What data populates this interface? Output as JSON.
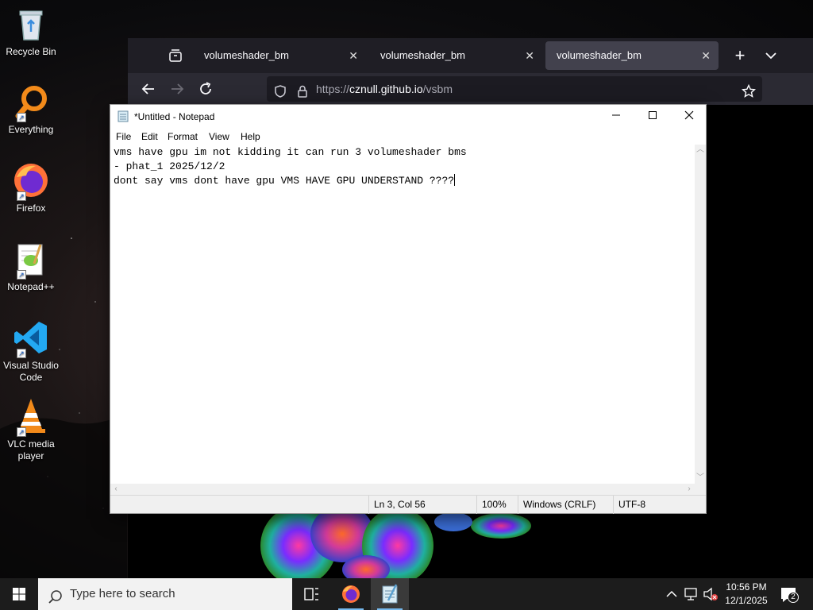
{
  "desktop": {
    "icons": [
      {
        "label": "Recycle Bin",
        "icon": "recycle-bin-icon"
      },
      {
        "label": "Everything",
        "icon": "everything-search-icon"
      },
      {
        "label": "Firefox",
        "icon": "firefox-icon"
      },
      {
        "label": "Notepad++",
        "icon": "notepadpp-icon"
      },
      {
        "label": "Visual Studio Code",
        "icon": "vscode-icon"
      },
      {
        "label": "VLC media player",
        "icon": "vlc-icon"
      }
    ]
  },
  "firefox": {
    "tabs": [
      {
        "title": "volumeshader_bm",
        "active": false
      },
      {
        "title": "volumeshader_bm",
        "active": false
      },
      {
        "title": "volumeshader_bm",
        "active": true
      }
    ],
    "url": {
      "prefix": "https://",
      "domain": "cznull.github.io",
      "path": "/vsbm"
    }
  },
  "notepad": {
    "title": "*Untitled - Notepad",
    "menu": [
      "File",
      "Edit",
      "Format",
      "View",
      "Help"
    ],
    "lines": [
      "vms have gpu im not kidding it can run 3 volumeshader bms",
      "- phat_1 2025/12/2",
      "dont say vms dont have gpu VMS HAVE GPU UNDERSTAND ????"
    ],
    "status": {
      "position": "Ln 3, Col 56",
      "zoom": "100%",
      "line_ending": "Windows (CRLF)",
      "encoding": "UTF-8"
    }
  },
  "taskbar": {
    "search_placeholder": "Type here to search",
    "time": "10:56 PM",
    "date": "12/1/2025",
    "notification_count": "2"
  }
}
